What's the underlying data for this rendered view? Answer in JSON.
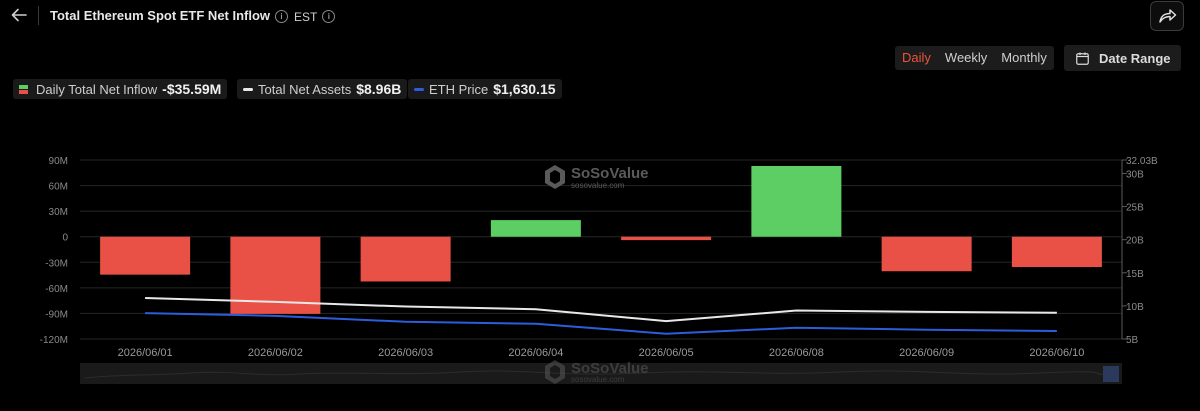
{
  "header": {
    "title": "Total Ethereum Spot ETF Net Inflow",
    "timezone": "EST"
  },
  "controls": {
    "periods": [
      "Daily",
      "Weekly",
      "Monthly"
    ],
    "active_period": "Daily",
    "date_range_label": "Date Range"
  },
  "legend": {
    "inflow": {
      "label": "Daily Total Net Inflow",
      "value": "-$35.59M"
    },
    "assets": {
      "label": "Total Net Assets",
      "value": "$8.96B"
    },
    "price": {
      "label": "ETH Price",
      "value": "$1,630.15"
    }
  },
  "watermark": {
    "brand": "SoSoValue",
    "domain": "sosovalue.com"
  },
  "colors": {
    "positive": "#5cce63",
    "negative": "#ea5146",
    "assets_line": "#e8e8e8",
    "price_line": "#2e5ddb",
    "active_tab": "#e8553b"
  },
  "chart_data": {
    "type": "bar",
    "categories": [
      "2026/06/01",
      "2026/06/02",
      "2026/06/03",
      "2026/06/04",
      "2026/06/05",
      "2026/06/08",
      "2026/06/09",
      "2026/06/10"
    ],
    "series": [
      {
        "name": "Daily Total Net Inflow",
        "type": "bar",
        "axis": "left",
        "values": [
          -44.5,
          -90.5,
          -52.5,
          19.5,
          -4,
          83,
          -40.5,
          -35.59
        ]
      },
      {
        "name": "Total Net Assets",
        "type": "line",
        "axis": "right",
        "values": [
          11.2,
          10.6,
          9.9,
          9.5,
          7.7,
          9.3,
          9.1,
          8.96
        ]
      },
      {
        "name": "ETH Price",
        "type": "line",
        "axis": "right",
        "values": [
          8.9,
          8.5,
          7.6,
          7.3,
          5.8,
          6.7,
          6.4,
          6.2
        ]
      }
    ],
    "left_axis": {
      "ticks": [
        "90M",
        "60M",
        "30M",
        "0",
        "-30M",
        "-60M",
        "-90M",
        "-120M"
      ],
      "ylim": [
        -120,
        90
      ]
    },
    "right_axis": {
      "ticks": [
        "32.03B",
        "30B",
        "25B",
        "20B",
        "15B",
        "10B",
        "5B"
      ],
      "ylim": [
        5,
        32.03
      ]
    },
    "grid": true
  }
}
